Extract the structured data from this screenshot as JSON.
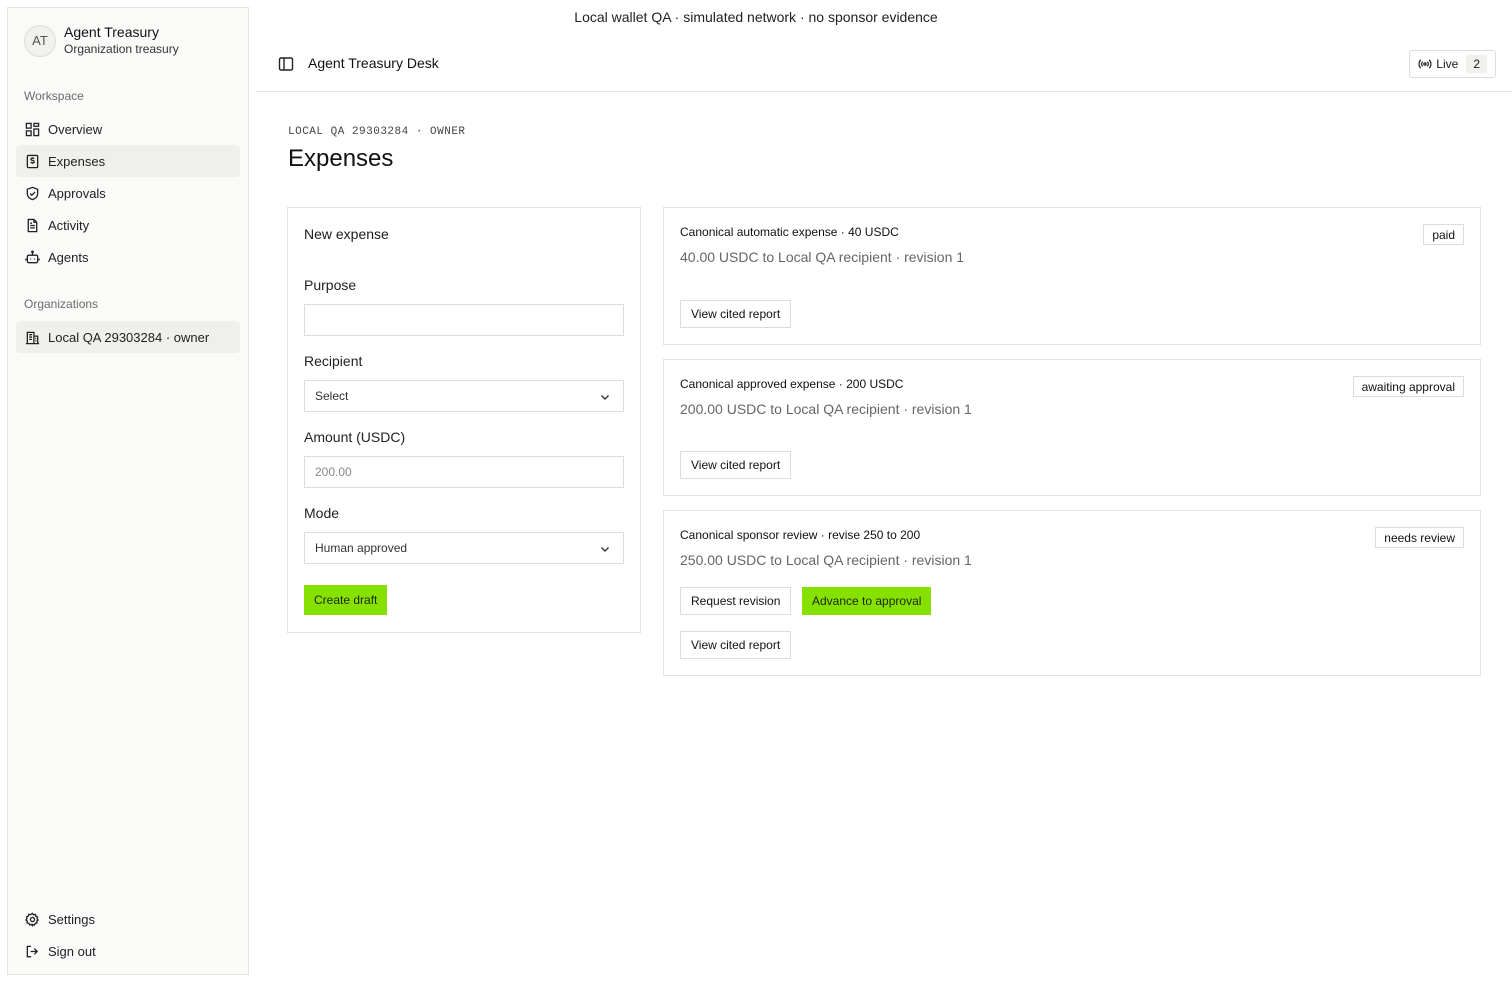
{
  "banner": "Local wallet QA · simulated network · no sponsor evidence",
  "sidebar": {
    "avatar": "AT",
    "title": "Agent Treasury",
    "subtitle": "Organization treasury",
    "workspace_label": "Workspace",
    "items": [
      {
        "label": "Overview",
        "icon": "grid-icon"
      },
      {
        "label": "Expenses",
        "icon": "receipt-icon",
        "active": true
      },
      {
        "label": "Approvals",
        "icon": "shield-check-icon"
      },
      {
        "label": "Activity",
        "icon": "document-icon"
      },
      {
        "label": "Agents",
        "icon": "robot-icon"
      }
    ],
    "orgs_label": "Organizations",
    "org_item": "Local QA 29303284 · owner",
    "settings": "Settings",
    "signout": "Sign out"
  },
  "header": {
    "title": "Agent Treasury Desk",
    "live_label": "Live",
    "live_count": "2"
  },
  "page": {
    "eyebrow": "LOCAL QA 29303284 · OWNER",
    "title": "Expenses"
  },
  "form": {
    "title": "New expense",
    "purpose_label": "Purpose",
    "purpose_value": "",
    "recipient_label": "Recipient",
    "recipient_value": "Select",
    "amount_label": "Amount (USDC)",
    "amount_placeholder": "200.00",
    "mode_label": "Mode",
    "mode_value": "Human approved",
    "submit": "Create draft"
  },
  "expenses": [
    {
      "title": "Canonical automatic expense · 40 USDC",
      "subtitle": "40.00 USDC to Local QA recipient · revision 1",
      "status": "paid",
      "view": "View cited report"
    },
    {
      "title": "Canonical approved expense · 200 USDC",
      "subtitle": "200.00 USDC to Local QA recipient · revision 1",
      "status": "awaiting approval",
      "view": "View cited report"
    },
    {
      "title": "Canonical sponsor review · revise 250 to 200",
      "subtitle": "250.00 USDC to Local QA recipient · revision 1",
      "status": "needs review",
      "request_revision": "Request revision",
      "advance": "Advance to approval",
      "view": "View cited report"
    }
  ]
}
